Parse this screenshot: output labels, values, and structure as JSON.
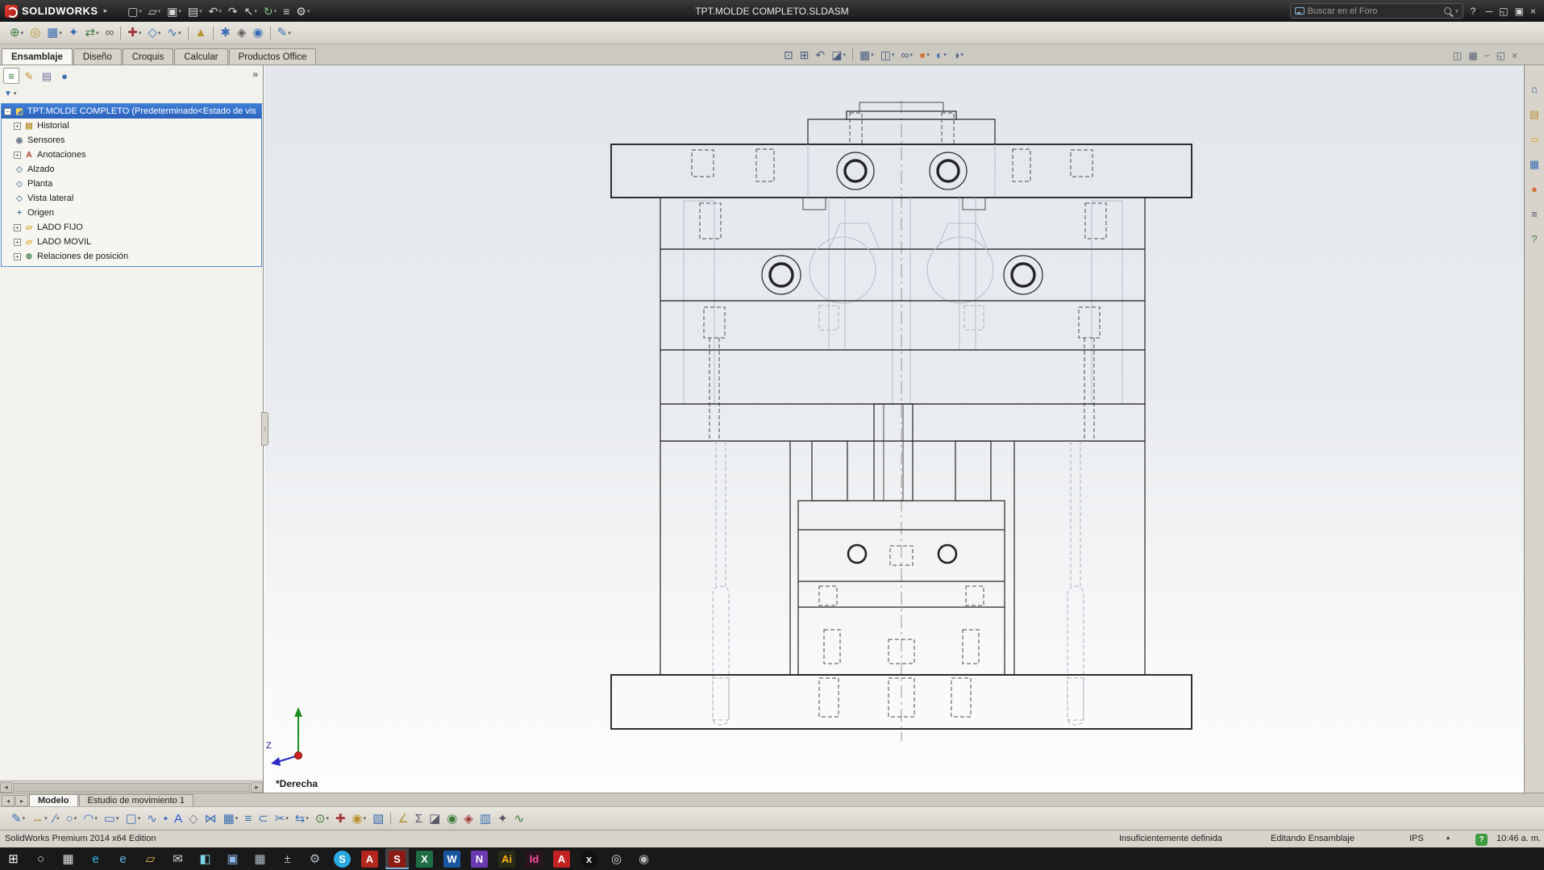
{
  "titlebar": {
    "logo": "SOLIDWORKS",
    "menu_arrow": "▸",
    "title": "TPT.MOLDE COMPLETO.SLDASM",
    "search_placeholder": "Buscar en el Foro",
    "search_caret": "▾",
    "tools": [
      {
        "name": "new-document-icon",
        "glyph": "▢",
        "caret": "▾",
        "inter": "true"
      },
      {
        "name": "open-icon",
        "glyph": "▱",
        "caret": "▾",
        "inter": "true"
      },
      {
        "name": "save-icon",
        "glyph": "▣",
        "caret": "▾",
        "inter": "true"
      },
      {
        "name": "print-icon",
        "glyph": "▤",
        "caret": "▾",
        "inter": "true"
      },
      {
        "name": "undo-icon",
        "glyph": "↶",
        "caret": "▾",
        "inter": "true"
      },
      {
        "name": "redo-icon",
        "glyph": "↷",
        "inter": "true"
      },
      {
        "name": "select-icon",
        "glyph": "↖",
        "caret": "▾",
        "inter": "true"
      },
      {
        "name": "rebuild-icon",
        "glyph": "↻",
        "color": "#7fc07f",
        "caret": "▾",
        "inter": "true"
      },
      {
        "name": "file-properties-icon",
        "glyph": "≡",
        "inter": "true"
      },
      {
        "name": "options-icon",
        "glyph": "⚙",
        "caret": "▾",
        "inter": "true"
      }
    ],
    "window_controls": [
      {
        "name": "help-icon",
        "glyph": "?",
        "caret": "▾",
        "inter": "true"
      },
      {
        "name": "minimize-icon",
        "glyph": "─",
        "inter": "true"
      },
      {
        "name": "restore-icon",
        "glyph": "◱",
        "inter": "true"
      },
      {
        "name": "maximize-icon",
        "glyph": "▣",
        "inter": "true"
      },
      {
        "name": "close-icon",
        "glyph": "×",
        "inter": "true"
      }
    ]
  },
  "toolbar2": {
    "items": [
      {
        "name": "insert-components-icon",
        "glyph": "⊕",
        "color": "#3d7a3d",
        "caret": "▾",
        "inter": "true"
      },
      {
        "name": "mate-icon",
        "glyph": "◎",
        "color": "#b8912f",
        "inter": "true"
      },
      {
        "name": "linear-component-pattern-icon",
        "glyph": "▦",
        "color": "#3c6eb4",
        "caret": "▾",
        "inter": "true"
      },
      {
        "name": "smart-fasteners-icon",
        "glyph": "✦",
        "color": "#3c6eb4",
        "inter": "true"
      },
      {
        "name": "move-component-icon",
        "glyph": "⇄",
        "color": "#3d7a3d",
        "caret": "▾",
        "inter": "true"
      },
      {
        "name": "show-hidden-components-icon",
        "glyph": "∞",
        "color": "#5a5a5a",
        "inter": "true"
      },
      {
        "name": "separator",
        "glyph": "",
        "cls": "sep",
        "inter": "false"
      },
      {
        "name": "assembly-features-icon",
        "glyph": "✚",
        "color": "#a33a3a",
        "caret": "▾",
        "inter": "true"
      },
      {
        "name": "reference-geometry-icon",
        "glyph": "◇",
        "color": "#3c6eb4",
        "caret": "▾",
        "inter": "true"
      },
      {
        "name": "curves-icon",
        "glyph": "∿",
        "color": "#3c6eb4",
        "caret": "▾",
        "inter": "true"
      },
      {
        "name": "separator",
        "glyph": "",
        "cls": "sep",
        "inter": "false"
      },
      {
        "name": "instant3d-icon",
        "glyph": "▲",
        "color": "#b8912f",
        "inter": "true"
      },
      {
        "name": "separator",
        "glyph": "",
        "cls": "sep",
        "inter": "false"
      },
      {
        "name": "exploded-view-icon",
        "glyph": "✱",
        "color": "#3c6eb4",
        "inter": "true"
      },
      {
        "name": "interference-detection-icon",
        "glyph": "◈",
        "color": "#5a5a5a",
        "inter": "true"
      },
      {
        "name": "large-design-review-icon",
        "glyph": "◉",
        "color": "#3c6eb4",
        "inter": "true"
      },
      {
        "name": "separator",
        "glyph": "",
        "cls": "sep",
        "inter": "false"
      },
      {
        "name": "sketch-toggle-icon",
        "glyph": "✎",
        "color": "#3c6eb4",
        "caret": "▾",
        "inter": "true"
      }
    ]
  },
  "tabs": {
    "items": [
      {
        "name": "tab-ensamblaje",
        "label": "Ensamblaje",
        "cls": "active",
        "inter": "true"
      },
      {
        "name": "tab-diseno",
        "label": "Diseño",
        "inter": "true"
      },
      {
        "name": "tab-croquis",
        "label": "Croquis",
        "inter": "true"
      },
      {
        "name": "tab-calcular",
        "label": "Calcular",
        "inter": "true"
      },
      {
        "name": "tab-productos-office",
        "label": "Productos Office",
        "inter": "true"
      }
    ]
  },
  "headsup": {
    "items": [
      {
        "name": "zoom-to-fit-icon",
        "glyph": "⊡",
        "inter": "true"
      },
      {
        "name": "zoom-to-area-icon",
        "glyph": "⊞",
        "inter": "true"
      },
      {
        "name": "previous-view-icon",
        "glyph": "↶",
        "inter": "true"
      },
      {
        "name": "section-view-icon",
        "glyph": "◪",
        "caret": "▾",
        "inter": "true"
      },
      {
        "name": "separator",
        "glyph": "",
        "cls": "sep",
        "inter": "false"
      },
      {
        "name": "view-orientation-icon",
        "glyph": "▦",
        "caret": "▾",
        "inter": "true"
      },
      {
        "name": "display-style-icon",
        "glyph": "◫",
        "caret": "▾",
        "inter": "true"
      },
      {
        "name": "hide-show-items-icon",
        "glyph": "∞",
        "caret": "▾",
        "inter": "true"
      },
      {
        "name": "edit-appearance-icon",
        "glyph": "●",
        "color": "#d4763b",
        "caret": "▾",
        "inter": "true"
      },
      {
        "name": "apply-scene-icon",
        "glyph": "◐",
        "color": "#3c6eb4",
        "caret": "▾",
        "inter": "true"
      },
      {
        "name": "view-settings-icon",
        "glyph": "◑",
        "caret": "▾",
        "inter": "true"
      }
    ]
  },
  "doc_controls": {
    "items": [
      {
        "name": "viewport-split-icon",
        "glyph": "◫",
        "inter": "true"
      },
      {
        "name": "viewport-grid-icon",
        "glyph": "▦",
        "inter": "true"
      },
      {
        "name": "minimize-window-icon",
        "glyph": "−",
        "inter": "true"
      },
      {
        "name": "restore-window-icon",
        "glyph": "◱",
        "inter": "true"
      },
      {
        "name": "close-window-icon",
        "glyph": "×",
        "inter": "true"
      }
    ]
  },
  "feature_panel": {
    "flyout": "»",
    "filter_glyph": "▼",
    "filter_caret": "▾",
    "tabs": [
      {
        "name": "featuremanager-tab-icon",
        "glyph": "≡",
        "color": "#3d7a3d",
        "cls": "active",
        "inter": "true"
      },
      {
        "name": "propertymanager-tab-icon",
        "glyph": "✎",
        "color": "#b8912f",
        "inter": "true"
      },
      {
        "name": "configurationmanager-tab-icon",
        "glyph": "▤",
        "color": "#6a6a9a",
        "inter": "true"
      },
      {
        "name": "displaymanager-tab-icon",
        "glyph": "●",
        "color": "#3c6eb4",
        "inter": "true"
      }
    ],
    "tree": [
      {
        "name": "tree-item-root",
        "icon": "assembly-icon",
        "label": "TPT.MOLDE COMPLETO  (Predeterminado<Estado de vis",
        "glyph": "◩",
        "color": "#ffd24d",
        "expand": "−",
        "cls": "selected",
        "ind": "0px",
        "inter": "true"
      },
      {
        "name": "tree-item-historial",
        "icon": "history-folder-icon",
        "label": "Historial",
        "glyph": "▤",
        "color": "#b8912f",
        "expand": "+",
        "ind": "12px",
        "inter": "true"
      },
      {
        "name": "tree-item-sensores",
        "icon": "sensors-icon",
        "label": "Sensores",
        "glyph": "◉",
        "color": "#6a7a8a",
        "ind": "12px",
        "inter": "true"
      },
      {
        "name": "tree-item-anotaciones",
        "icon": "annotations-icon",
        "label": "Anotaciones",
        "glyph": "A",
        "color": "#b03a2e",
        "expand": "+",
        "ind": "12px",
        "inter": "true"
      },
      {
        "name": "tree-item-alzado",
        "icon": "plane-icon",
        "label": "Alzado",
        "glyph": "◇",
        "color": "#6b86ad",
        "ind": "12px",
        "inter": "true"
      },
      {
        "name": "tree-item-planta",
        "icon": "plane-icon",
        "label": "Planta",
        "glyph": "◇",
        "color": "#6b86ad",
        "ind": "12px",
        "inter": "true"
      },
      {
        "name": "tree-item-vista-lateral",
        "icon": "plane-icon",
        "label": "Vista lateral",
        "glyph": "◇",
        "color": "#6b86ad",
        "ind": "12px",
        "inter": "true"
      },
      {
        "name": "tree-item-origen",
        "icon": "origin-icon",
        "label": "Origen",
        "glyph": "+",
        "color": "#3a6ea5",
        "ind": "12px",
        "inter": "true"
      },
      {
        "name": "tree-item-lado-fijo",
        "icon": "folder-icon",
        "label": "LADO FIJO",
        "glyph": "▱",
        "color": "#d8a01d",
        "expand": "+",
        "ind": "12px",
        "inter": "true"
      },
      {
        "name": "tree-item-lado-movil",
        "icon": "folder-icon",
        "label": "LADO MOVIL",
        "glyph": "▱",
        "color": "#d8a01d",
        "expand": "+",
        "ind": "12px",
        "inter": "true"
      },
      {
        "name": "tree-item-relaciones-de-posicion",
        "icon": "mates-icon",
        "label": "Relaciones de posición",
        "glyph": "⊚",
        "color": "#3d7a3d",
        "expand": "+",
        "ind": "12px",
        "inter": "true"
      }
    ],
    "scroll_left": "◂",
    "scroll_right": "▸",
    "splitter_glyph": "⁞"
  },
  "taskpane": {
    "items": [
      {
        "name": "solidworks-resources-icon",
        "glyph": "⌂",
        "color": "#2f5fa0",
        "inter": "true"
      },
      {
        "name": "design-library-icon",
        "glyph": "▤",
        "color": "#b8912f",
        "inter": "true"
      },
      {
        "name": "file-explorer-icon",
        "glyph": "▱",
        "color": "#d8a01d",
        "inter": "true"
      },
      {
        "name": "view-palette-icon",
        "glyph": "▦",
        "color": "#3c6eb4",
        "inter": "true"
      },
      {
        "name": "appearances-icon",
        "glyph": "●",
        "color": "#d4763b",
        "inter": "true"
      },
      {
        "name": "custom-properties-icon",
        "glyph": "≡",
        "color": "#555566",
        "inter": "true"
      },
      {
        "name": "forum-icon",
        "glyph": "?",
        "color": "#3d7a3d",
        "inter": "true"
      }
    ]
  },
  "viewport": {
    "annotation": "*Derecha",
    "triad_z": "Z"
  },
  "bottom_tabs": {
    "nav_left": "◂",
    "nav_right": "▸",
    "items": [
      {
        "name": "model-tab",
        "label": "Modelo",
        "cls": "active",
        "inter": "true"
      },
      {
        "name": "motion-study-tab",
        "label": "Estudio de movimiento 1",
        "inter": "true"
      }
    ]
  },
  "bottom_toolbar": {
    "items": [
      {
        "name": "sketch-icon",
        "glyph": "✎",
        "color": "#3c6eb4",
        "caret": "▾",
        "inter": "true"
      },
      {
        "name": "smart-dimension-icon",
        "glyph": "↔",
        "color": "#b8912f",
        "caret": "▾",
        "inter": "true"
      },
      {
        "name": "line-icon",
        "glyph": "∕",
        "color": "#3c6eb4",
        "caret": "▾",
        "inter": "true"
      },
      {
        "name": "circle-icon",
        "glyph": "○",
        "color": "#3c6eb4",
        "caret": "▾",
        "inter": "true"
      },
      {
        "name": "arc-icon",
        "glyph": "◠",
        "color": "#3c6eb4",
        "caret": "▾",
        "inter": "true"
      },
      {
        "name": "rectangle-icon",
        "glyph": "▭",
        "color": "#3c6eb4",
        "caret": "▾",
        "inter": "true"
      },
      {
        "name": "slot-icon",
        "glyph": "▢",
        "color": "#3c6eb4",
        "caret": "▾",
        "inter": "true"
      },
      {
        "name": "spline-icon",
        "glyph": "∿",
        "color": "#3c6eb4",
        "inter": "true"
      },
      {
        "name": "point-icon",
        "glyph": "•",
        "color": "#3c6eb4",
        "inter": "true"
      },
      {
        "name": "text-icon",
        "glyph": "A",
        "color": "#2255cc",
        "inter": "true"
      },
      {
        "name": "plane-icon",
        "glyph": "◇",
        "color": "#777788",
        "inter": "true"
      },
      {
        "name": "mirror-entities-icon",
        "glyph": "⋈",
        "color": "#3c6eb4",
        "inter": "true"
      },
      {
        "name": "sketch-pattern-icon",
        "glyph": "▦",
        "color": "#3c6eb4",
        "caret": "▾",
        "inter": "true"
      },
      {
        "name": "offset-entities-icon",
        "glyph": "≡",
        "color": "#3c6eb4",
        "inter": "true"
      },
      {
        "name": "convert-entities-icon",
        "glyph": "⊂",
        "color": "#3c6eb4",
        "inter": "true"
      },
      {
        "name": "trim-entities-icon",
        "glyph": "✂",
        "color": "#3c6eb4",
        "caret": "▾",
        "inter": "true"
      },
      {
        "name": "move-entities-icon",
        "glyph": "⇆",
        "color": "#3c6eb4",
        "caret": "▾",
        "inter": "true"
      },
      {
        "name": "display-relations-icon",
        "glyph": "⊙",
        "color": "#3d7a3d",
        "caret": "▾",
        "inter": "true"
      },
      {
        "name": "repair-sketch-icon",
        "glyph": "✚",
        "color": "#a33a3a",
        "inter": "true"
      },
      {
        "name": "quick-snaps-icon",
        "glyph": "◉",
        "color": "#b8912f",
        "caret": "▾",
        "inter": "true"
      },
      {
        "name": "rapid-sketch-icon",
        "glyph": "▧",
        "color": "#3c6eb4",
        "inter": "true"
      },
      {
        "name": "separator",
        "glyph": "",
        "cls": "sep",
        "inter": "false"
      },
      {
        "name": "measure-icon",
        "glyph": "∠",
        "color": "#b8912f",
        "inter": "true"
      },
      {
        "name": "mass-properties-icon",
        "glyph": "Σ",
        "color": "#555566",
        "inter": "true"
      },
      {
        "name": "section-properties-icon",
        "glyph": "◪",
        "color": "#555566",
        "inter": "true"
      },
      {
        "name": "sensors-icon",
        "glyph": "◉",
        "color": "#3d7a3d",
        "inter": "true"
      },
      {
        "name": "interference-detection-icon",
        "glyph": "◈",
        "color": "#a33a3a",
        "inter": "true"
      },
      {
        "name": "assembly-visualization-icon",
        "glyph": "▥",
        "color": "#3c6eb4",
        "inter": "true"
      },
      {
        "name": "performance-evaluation-icon",
        "glyph": "✦",
        "color": "#555566",
        "inter": "true"
      },
      {
        "name": "curvature-icon",
        "glyph": "∿",
        "color": "#3d7a3d",
        "inter": "true"
      }
    ]
  },
  "statusbar": {
    "app": "SolidWorks Premium 2014 x64 Edition",
    "definition": "Insuficientemente definida",
    "mode": "Editando Ensamblaje",
    "units": "IPS",
    "units_caret": "▴",
    "help_glyph": "?",
    "time": "10:46 a. m."
  },
  "taskbar": {
    "items": [
      {
        "name": "start-button",
        "glyph": "⊞",
        "fg": "#ffffff",
        "cls": "plain",
        "inter": "true"
      },
      {
        "name": "search-icon",
        "glyph": "○",
        "fg": "#dddddd",
        "cls": "plain",
        "inter": "true"
      },
      {
        "name": "task-view-icon",
        "glyph": "▦",
        "fg": "#dddddd",
        "cls": "plain",
        "inter": "true"
      },
      {
        "name": "edge-icon",
        "glyph": "e",
        "fg": "#35b8e8",
        "cls": "plain",
        "inter": "true"
      },
      {
        "name": "internet-explorer-icon",
        "glyph": "e",
        "fg": "#6ab9f0",
        "cls": "plain",
        "inter": "true"
      },
      {
        "name": "file-explorer-icon",
        "glyph": "▱",
        "fg": "#f0c24b",
        "cls": "plain",
        "inter": "true"
      },
      {
        "name": "mail-icon",
        "glyph": "✉",
        "fg": "#cfd8dc",
        "cls": "plain",
        "inter": "true"
      },
      {
        "name": "store-icon",
        "glyph": "◧",
        "fg": "#7fd5e8",
        "cls": "plain",
        "inter": "true"
      },
      {
        "name": "photos-icon",
        "glyph": "▣",
        "fg": "#8fb8e8",
        "cls": "plain",
        "inter": "true"
      },
      {
        "name": "calendar-icon",
        "glyph": "▦",
        "fg": "#b0bec5",
        "cls": "plain",
        "inter": "true"
      },
      {
        "name": "calculator-icon",
        "glyph": "±",
        "fg": "#b0bec5",
        "cls": "plain",
        "inter": "true"
      },
      {
        "name": "settings-icon",
        "glyph": "⚙",
        "fg": "#b0bec5",
        "cls": "plain",
        "inter": "true"
      },
      {
        "name": "skype-icon",
        "glyph": "S",
        "fg": "#ffffff",
        "bg": "#2aa8e0",
        "cls": "round",
        "inter": "true"
      },
      {
        "name": "adobe-reader-icon",
        "glyph": "A",
        "fg": "#ffffff",
        "bg": "#b3261e",
        "inter": "true"
      },
      {
        "name": "solidworks-icon",
        "glyph": "S",
        "fg": "#ffffff",
        "bg": "#8c1c13",
        "cls": "active",
        "inter": "true"
      },
      {
        "name": "excel-icon",
        "glyph": "X",
        "fg": "#ffffff",
        "bg": "#1f6e43",
        "inter": "true"
      },
      {
        "name": "word-icon",
        "glyph": "W",
        "fg": "#ffffff",
        "bg": "#1a56a0",
        "inter": "true"
      },
      {
        "name": "onenote-icon",
        "glyph": "N",
        "fg": "#ffffff",
        "bg": "#6a3ab2",
        "inter": "true"
      },
      {
        "name": "illustrator-icon",
        "glyph": "Ai",
        "fg": "#ffb300",
        "bg": "#2b2b1a",
        "inter": "true"
      },
      {
        "name": "indesign-icon",
        "glyph": "Id",
        "fg": "#ff4f9a",
        "bg": "#2b1420",
        "inter": "true"
      },
      {
        "name": "acrobat-icon",
        "glyph": "A",
        "fg": "#ffffff",
        "bg": "#c22222",
        "inter": "true"
      },
      {
        "name": "xbox-icon",
        "glyph": "x",
        "fg": "#eeeeee",
        "bg": "#111111",
        "cls": "round",
        "inter": "true"
      },
      {
        "name": "camera-icon",
        "glyph": "◎",
        "fg": "#dddddd",
        "cls": "plain",
        "inter": "true"
      },
      {
        "name": "steam-icon",
        "glyph": "◉",
        "fg": "#bbbbbb",
        "cls": "plain",
        "inter": "true"
      }
    ]
  }
}
